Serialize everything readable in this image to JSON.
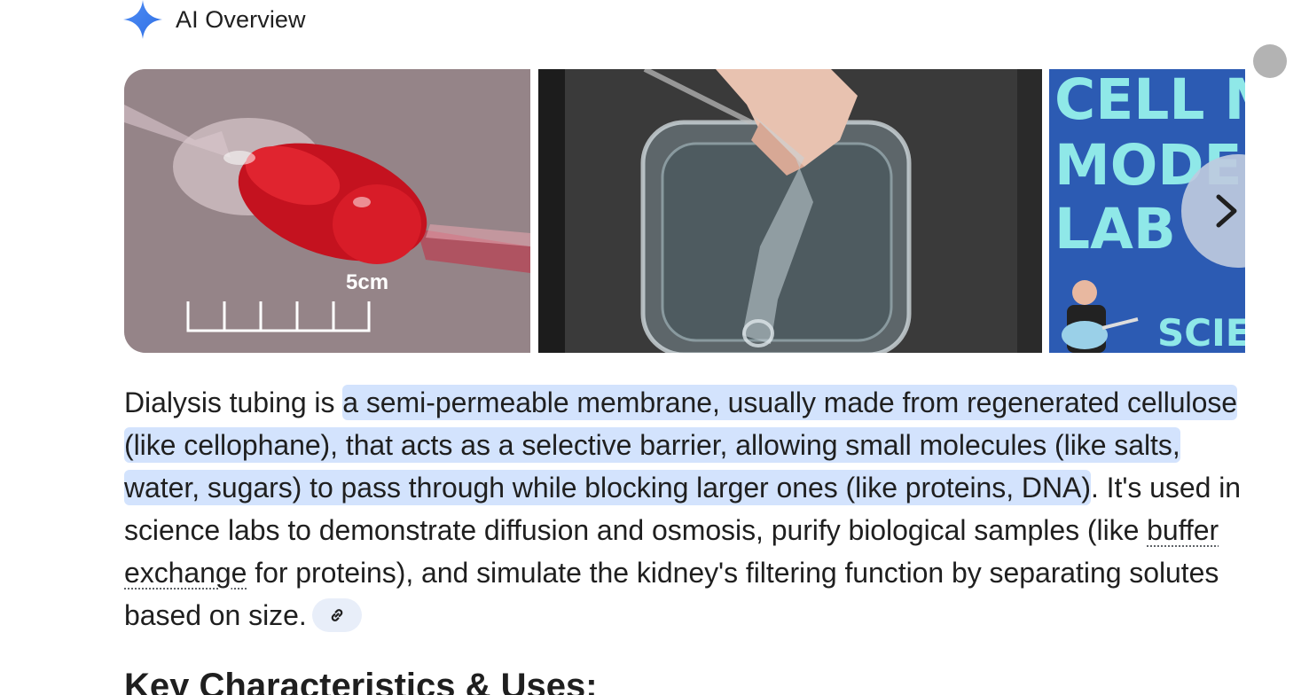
{
  "header": {
    "title": "AI Overview",
    "icon": "sparkle-icon",
    "accent_color": "#4285f4"
  },
  "carousel": {
    "images": [
      {
        "name": "dialysis-tube-red",
        "scale_label": "5cm"
      },
      {
        "name": "membrane-in-water-dish"
      },
      {
        "name": "cell-membrane-model-lab",
        "caption_lines": [
          "CELL M",
          "MODEL",
          "LAB"
        ],
        "footer_text": "SCIEN"
      }
    ],
    "next_icon": "chevron-right-icon"
  },
  "overview": {
    "intro": "Dialysis tubing is ",
    "highlight": "a semi-permeable membrane, usually made from regenerated cellulose (like cellophane), that acts as a selective barrier, allowing small molecules (like salts, water, sugars) to pass through while blocking larger ones (like proteins, DNA)",
    "text_after_highlight": ". It's used in science labs to demonstrate diffusion and osmosis, purify biological samples (like ",
    "term": "buffer exchange",
    "text_end": " for proteins), and simulate the kidney's filtering function by separating solutes based on size.",
    "highlight_color": "#d3e3fd",
    "link_icon": "link-icon"
  },
  "section": {
    "heading": "Key Characteristics & Uses:"
  }
}
